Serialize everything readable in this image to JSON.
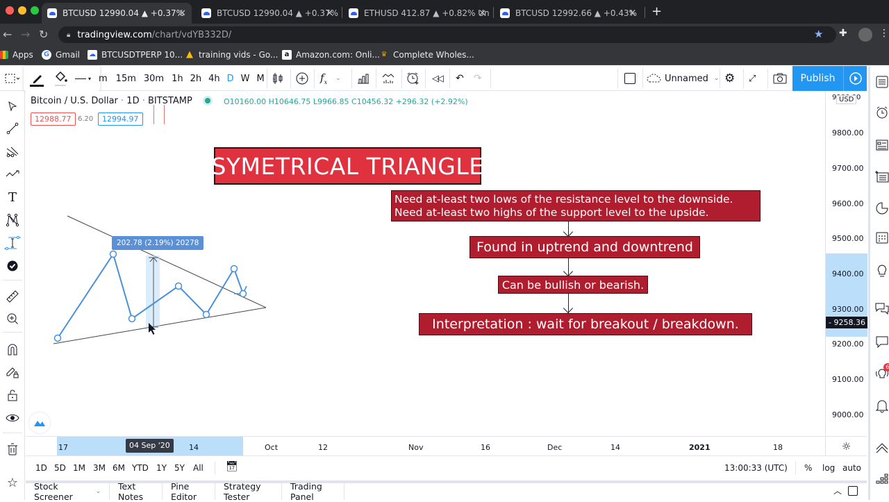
{
  "browser": {
    "tabs": [
      {
        "title": "BTCUSD 12990.04 ▲ +0.37% ",
        "active": true
      },
      {
        "title": "BTCUSD 12990.04 ▲ +0.37% ",
        "active": false
      },
      {
        "title": "ETHUSD 412.87 ▲ +0.82% Un",
        "active": false
      },
      {
        "title": "BTCUSD 12992.66 ▲ +0.43% ",
        "active": false
      }
    ],
    "new_tab_label": "+",
    "url_host": "tradingview.com",
    "url_path": "/chart/vdYB332D/",
    "bookmarks": [
      {
        "label": "Apps",
        "icon": "apps-grid-icon"
      },
      {
        "label": "Gmail",
        "icon": "google-icon"
      },
      {
        "label": "BTCUSDTPERP 10...",
        "icon": "tradingview-icon"
      },
      {
        "label": "training vids - Go...",
        "icon": "google-drive-icon"
      },
      {
        "label": "Amazon.com: Onli...",
        "icon": "amazon-icon"
      },
      {
        "label": "Complete Wholes...",
        "icon": "crown-icon"
      }
    ]
  },
  "toolbar": {
    "intervals": [
      "m",
      "15m",
      "30m",
      "1h",
      "2h",
      "4h",
      "D",
      "W",
      "M"
    ],
    "active_interval": "D",
    "layout_name": "Unnamed",
    "publish_label": "Publish"
  },
  "legend": {
    "symbol_name": "Bitcoin / U.S. Dollar",
    "interval": "1D",
    "exchange": "BITSTAMP",
    "open": "O10160.00",
    "high": "H10646.75",
    "low": "L9966.85",
    "close": "C10456.32",
    "change": "+296.32 (+2.92%)",
    "bid": "12988.77",
    "spread": "6.20",
    "ask": "12994.97"
  },
  "annotations": {
    "title": "SYMETRICAL TRIANGLE",
    "box1_line1": "Need at-least  two lows of the resistance level to the downside.",
    "box1_line2": "Need at-least two highs of the support level to the upside.",
    "box2": "Found in uptrend and downtrend",
    "box3": "Can be bullish or bearish.",
    "box4": "Interpretation : wait for breakout / breakdown.",
    "measure_label": "202.78 (2.19%) 20278"
  },
  "price_axis": {
    "currency": "USD",
    "labels": [
      "9800.00",
      "9700.00",
      "9600.00",
      "9500.00",
      "9400.00",
      "9300.00",
      "9200.00",
      "9100.00",
      "9000.00"
    ],
    "top_partial": "9900.00",
    "current_price": "9258.36"
  },
  "time_axis": {
    "labels": [
      "17",
      "14",
      "Oct",
      "12",
      "Nov",
      "16",
      "Dec",
      "14",
      "2021",
      "18"
    ],
    "crosshair_date": "04 Sep '20"
  },
  "bottom_bar": {
    "ranges": [
      "1D",
      "5D",
      "1M",
      "3M",
      "6M",
      "YTD",
      "1Y",
      "5Y",
      "All"
    ],
    "clock": "13:00:33 (UTC)",
    "percent_label": "%",
    "log_label": "log",
    "auto_label": "auto"
  },
  "panel_tabs": [
    "Stock Screener",
    "Text Notes",
    "Pine Editor",
    "Strategy Tester",
    "Trading Panel"
  ],
  "colors": {
    "accent": "#2196f3",
    "annotation_red": "#b01d2e",
    "title_red": "#e0313f",
    "drawing_blue": "#4a90d9",
    "bid_red": "#ef5350",
    "ask_blue": "#2196f3",
    "up_green": "#26a69a"
  }
}
